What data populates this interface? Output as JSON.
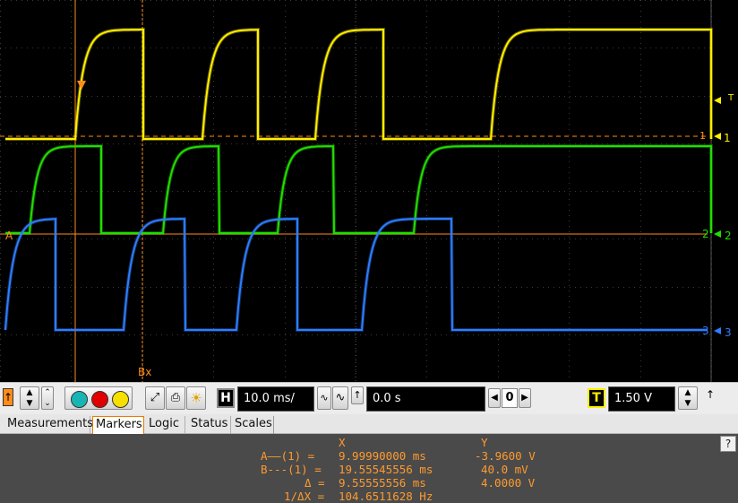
{
  "scope": {
    "cursor_a_label": "A",
    "cursor_b_label": "Bx",
    "channels": [
      {
        "id": "1",
        "label": "1",
        "color": "#ffee00"
      },
      {
        "id": "2",
        "label": "2",
        "color": "#22dd00"
      },
      {
        "id": "3",
        "label": "3",
        "color": "#2e7dff"
      }
    ],
    "trigger_marker": "T",
    "cursor_color": "#ff8c1a",
    "channel1_ref_label": "1"
  },
  "toolbar": {
    "horizontal_button": "H",
    "timebase": "10.0 ms/",
    "delay": "0.0 s",
    "position_value": "0",
    "trigger_button": "T",
    "trigger_level": "1.50 V",
    "run_colors": [
      "#19b5b5",
      "#e00000",
      "#f5e000"
    ]
  },
  "tabs": [
    {
      "label": "Measurements",
      "active": false
    },
    {
      "label": "Markers",
      "active": true
    },
    {
      "label": "Logic",
      "active": false
    },
    {
      "label": "Status",
      "active": false
    },
    {
      "label": "Scales",
      "active": false
    }
  ],
  "markers": {
    "col_x": "X",
    "col_y": "Y",
    "rows": [
      {
        "label": "A——(1) =",
        "x": "9.99990000 ms",
        "y": "-3.9600 V"
      },
      {
        "label": "B---(1) =",
        "x": "19.55545556 ms",
        "y": "40.0 mV"
      },
      {
        "label": "Δ =",
        "x": "9.55555556 ms",
        "y": "4.0000 V"
      },
      {
        "label": "1/ΔX =",
        "x": "104.6511628 Hz",
        "y": ""
      }
    ],
    "help": "?"
  }
}
